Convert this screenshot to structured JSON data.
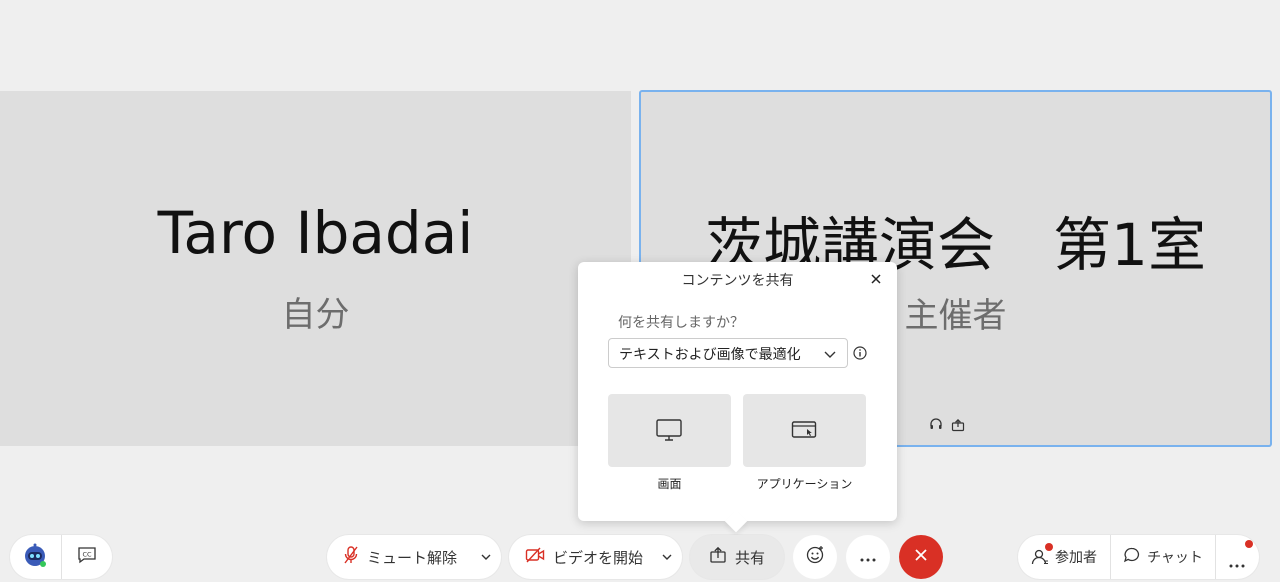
{
  "tiles": {
    "self": {
      "name": "Taro Ibadai",
      "role": "自分"
    },
    "host": {
      "name": "茨城講演会　第1室",
      "role": "主催者"
    }
  },
  "share_popover": {
    "title": "コンテンツを共有",
    "question": "何を共有しますか？",
    "optimize_select_value": "テキストおよび画像で最適化",
    "options": [
      {
        "label": "画面",
        "icon": "monitor-icon"
      },
      {
        "label": "アプリケーション",
        "icon": "app-window-icon"
      }
    ]
  },
  "toolbar": {
    "mute_label": "ミュート解除",
    "video_label": "ビデオを開始",
    "share_label": "共有",
    "participants_label": "参加者",
    "chat_label": "チャット"
  },
  "colors": {
    "accent_border": "#79b2ee",
    "end_call": "#d93025",
    "notification_dot": "#d93025",
    "muted_icon": "#d93025"
  }
}
